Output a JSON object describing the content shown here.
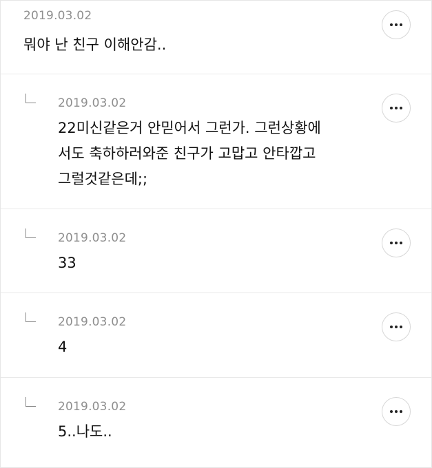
{
  "comments": [
    {
      "date": "2019.03.02",
      "text": "뭐야 난 친구 이해안감..",
      "more_icon": "more-dots-icon"
    },
    {
      "date": "2019.03.02",
      "lines": [
        "22미신같은거 안믿어서 그런가. 그런상황에",
        "서도 축하하러와준 친구가 고맙고 안타깝고",
        "그럴것같은데;;"
      ],
      "reply_icon": "reply-arrow-icon",
      "more_icon": "more-dots-icon"
    },
    {
      "date": "2019.03.02",
      "text": "33",
      "reply_icon": "reply-arrow-icon",
      "more_icon": "more-dots-icon"
    },
    {
      "date": "2019.03.02",
      "text": "4",
      "reply_icon": "reply-arrow-icon",
      "more_icon": "more-dots-icon"
    },
    {
      "date": "2019.03.02",
      "text": "5..나도..",
      "reply_icon": "reply-arrow-icon",
      "more_icon": "more-dots-icon"
    }
  ]
}
